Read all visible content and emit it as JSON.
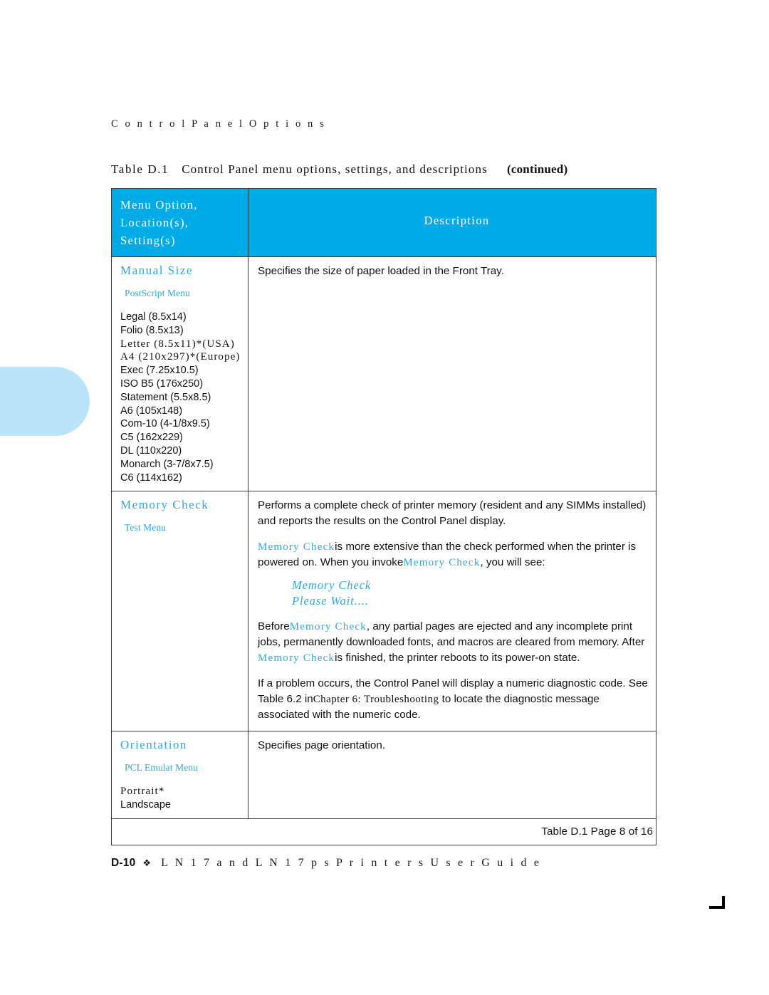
{
  "running_header": "C o n t r o l   P a n e l   O p t i o n s",
  "caption": {
    "label": "Table D.1",
    "title": "Control Panel menu options, settings, and descriptions",
    "continued": "(continued)"
  },
  "table": {
    "header": {
      "col1_line1": "Menu Option,",
      "col1_line2": "Location(s),",
      "col1_line3": "Setting(s)",
      "col2": "Description"
    },
    "rows": [
      {
        "title": "Manual Size",
        "location": "PostScript Menu",
        "settings": [
          "Legal (8.5x14)",
          "Folio (8.5x13)",
          "Letter (8.5x11)*(USA)",
          "A4 (210x297)*(Europe)",
          "Exec (7.25x10.5)",
          "ISO B5 (176x250)",
          "Statement (5.5x8.5)",
          "A6 (105x148)",
          "Com-10 (4-1/8x9.5)",
          "C5 (162x229)",
          "DL (110x220)",
          "Monarch (3-7/8x7.5)",
          "C6 (114x162)"
        ],
        "description_p1": "Specifies the size of paper loaded in the Front Tray."
      },
      {
        "title": "Memory Check",
        "location": "Test Menu",
        "settings": [],
        "p1_line1": "Performs a complete check of printer memory (resident and any SIMMs installed)",
        "p1_line2": "and reports the results on the Control Panel display.",
        "p2_term1": "Memory Check",
        "p2_text1": "is more extensive than the check performed when the printer is",
        "p2_text2": "powered on. When you invoke",
        "p2_term2": "Memory Check",
        "p2_text3": ", you will see:",
        "display_line1": "Memory Check",
        "display_line2": "Please Wait....",
        "p3_text1": "Before",
        "p3_term1": "Memory Check",
        "p3_text2": ", any partial pages are ejected and any incomplete print",
        "p3_line2": "jobs, permanently downloaded fonts, and macros are cleared from memory. After",
        "p3_term2": "Memory Check",
        "p3_text3": "is finished, the printer reboots to its power-on state.",
        "p4_line1": "If a problem occurs, the Control Panel will display a numeric diagnostic code. See",
        "p4_text1": "Table 6.2 in",
        "p4_term1": "Chapter 6: Troubleshooting",
        "p4_text2": "to locate the diagnostic message",
        "p4_line3": "associated with the numeric code."
      },
      {
        "title": "Orientation",
        "location": "PCL Emulat Menu",
        "settings": [
          "Portrait*",
          "Landscape"
        ],
        "description_p1": "Specifies page orientation."
      }
    ],
    "footer": "Table D.1  Page 8 of 16"
  },
  "page_footer": {
    "page_number": "D-10",
    "diamond": "❖",
    "title": "L N 1 7   a n d   L N 1 7 p s   P r i n t e r s   U s e r   G u i d e"
  },
  "colors": {
    "header_fill": "#00ACE8",
    "accent_cyan": "#29A9E0",
    "margin_tab": "#B9E4FA",
    "text": "#111111"
  }
}
